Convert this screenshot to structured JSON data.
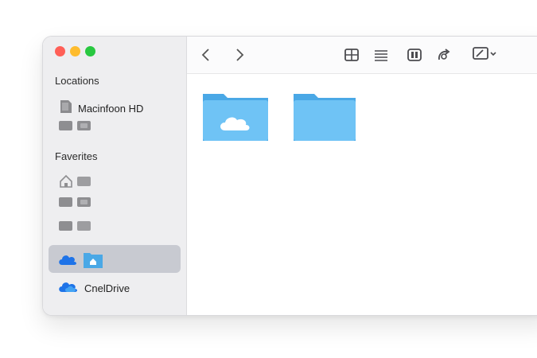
{
  "sidebar": {
    "sections": {
      "locations": "Locations",
      "favorites": "Faverites"
    },
    "locations": [
      {
        "label": "Macinfoon HD",
        "icon": "hard-drive-icon"
      }
    ],
    "cloud_item": {
      "label": "CnelDrive",
      "icon": "cloud-icon"
    }
  },
  "toolbar": {
    "back_icon": "chevron-left-icon",
    "forward_icon": "chevron-right-icon",
    "view_icons": [
      "grid-view-icon",
      "list-view-icon",
      "column-view-icon",
      "share-icon",
      "edit-icon"
    ]
  },
  "colors": {
    "accent": "#1e73e8",
    "folder": "#6fc3f5",
    "folder_dark": "#4aa8e6",
    "sidebar_bg": "#eeeef0",
    "selected_bg": "#c8cad1"
  }
}
